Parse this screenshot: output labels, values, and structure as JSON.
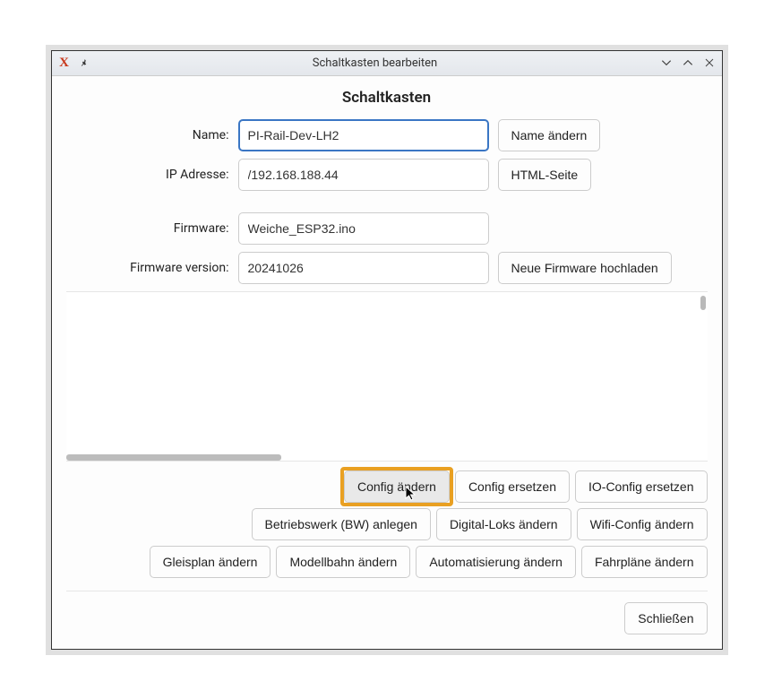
{
  "window": {
    "title": "Schaltkasten bearbeiten"
  },
  "page": {
    "heading": "Schaltkasten"
  },
  "fields": {
    "name": {
      "label": "Name:",
      "value": "PI-Rail-Dev-LH2",
      "button": "Name ändern"
    },
    "ip": {
      "label": "IP Adresse:",
      "value": "/192.168.188.44",
      "button": "HTML-Seite"
    },
    "firmware": {
      "label": "Firmware:",
      "value": "Weiche_ESP32.ino"
    },
    "firmware_version": {
      "label": "Firmware version:",
      "value": "20241026",
      "button": "Neue Firmware hochladen"
    }
  },
  "buttons": {
    "row1": {
      "config_aendern": "Config ändern",
      "config_ersetzen": "Config ersetzen",
      "io_config_ersetzen": "IO-Config ersetzen"
    },
    "row2": {
      "bw_anlegen": "Betriebswerk (BW) anlegen",
      "digital_loks": "Digital-Loks ändern",
      "wifi_config": "Wifi-Config ändern"
    },
    "row3": {
      "gleisplan": "Gleisplan ändern",
      "modellbahn": "Modellbahn ändern",
      "automatisierung": "Automatisierung ändern",
      "fahrplaene": "Fahrpläne ändern"
    }
  },
  "close": "Schließen"
}
